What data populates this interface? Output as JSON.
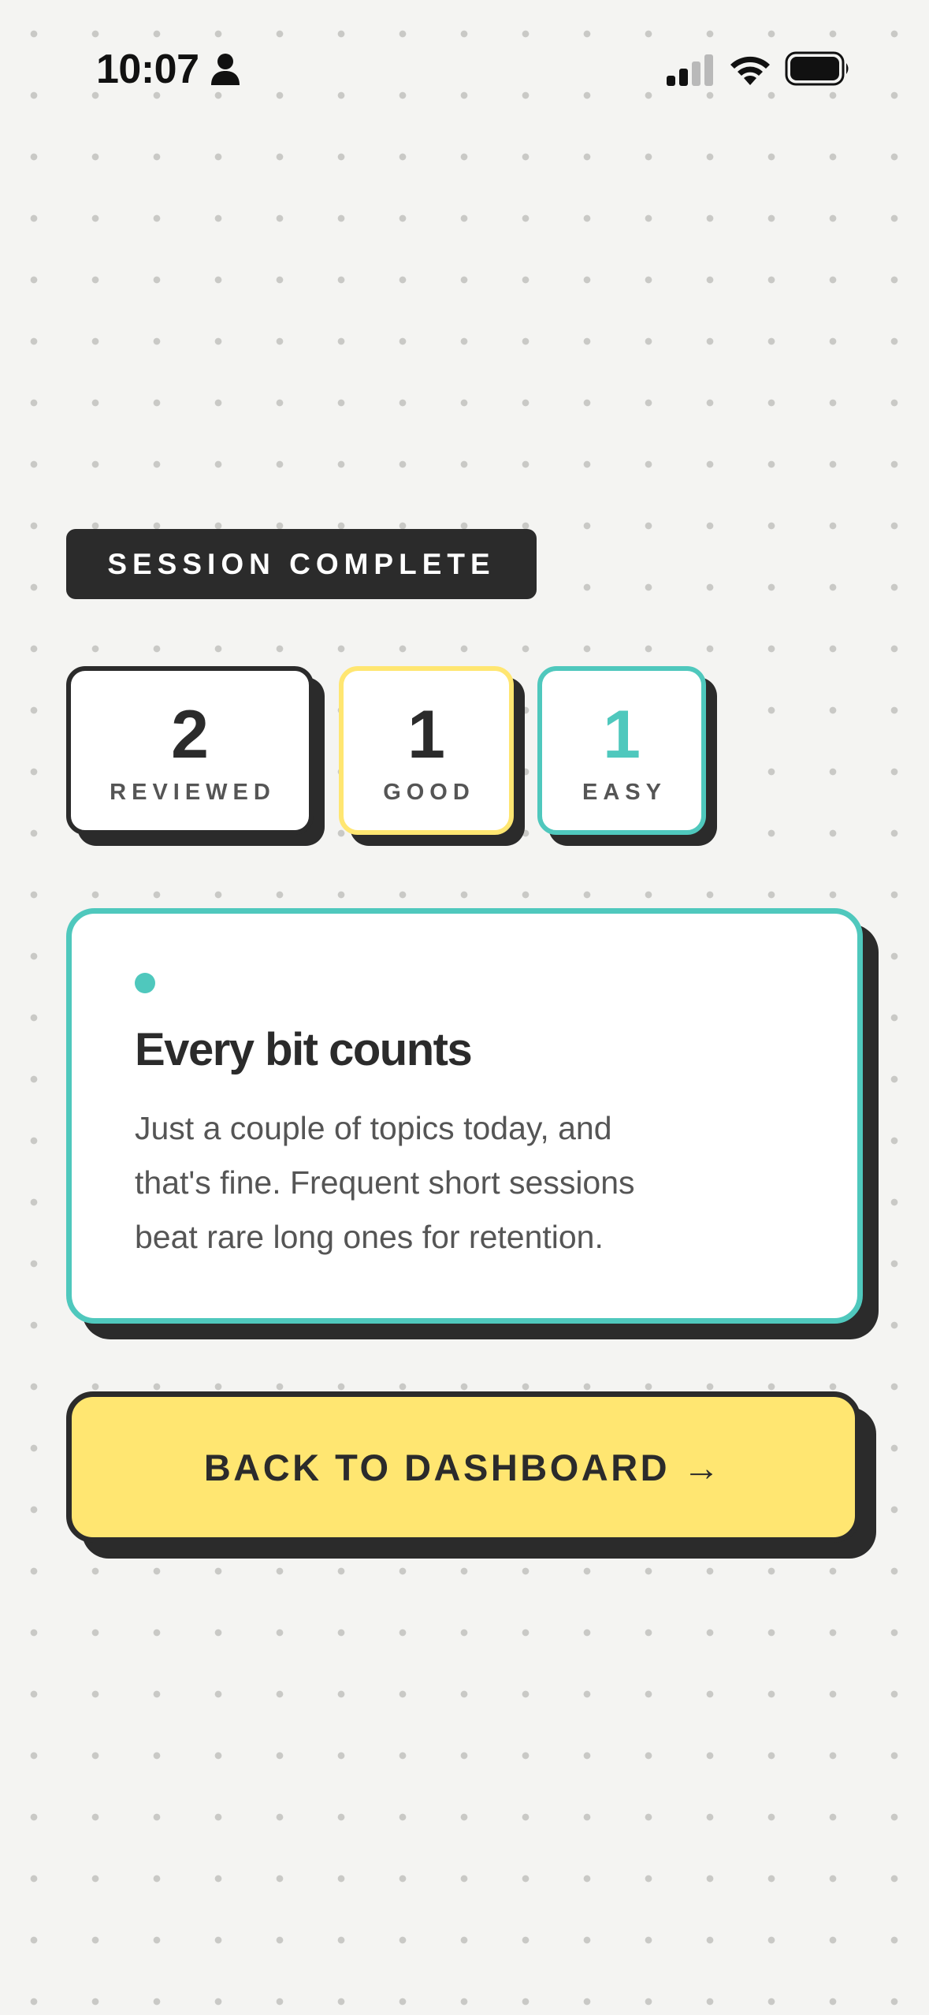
{
  "status_bar": {
    "time": "10:07",
    "icons": [
      "person-icon",
      "cellular-signal-icon",
      "wifi-icon",
      "battery-icon"
    ]
  },
  "session": {
    "badge_label": "SESSION COMPLETE"
  },
  "stats": [
    {
      "value": "2",
      "label": "REVIEWED",
      "border_color": "#2b2b2b"
    },
    {
      "value": "1",
      "label": "GOOD",
      "border_color": "#ffe671"
    },
    {
      "value": "1",
      "label": "EASY",
      "border_color": "#4fc8bd"
    }
  ],
  "message": {
    "title": "Every bit counts",
    "lines": [
      "Just a couple of topics today, and",
      "that's fine. Frequent short sessions",
      "beat rare long ones for retention."
    ]
  },
  "actions": {
    "back_label": "BACK TO DASHBOARD →"
  },
  "colors": {
    "background": "#f4f4f2",
    "ink": "#2b2b2b",
    "accent_teal": "#4fc8bd",
    "accent_yellow": "#ffe671",
    "muted_text": "#555555"
  }
}
